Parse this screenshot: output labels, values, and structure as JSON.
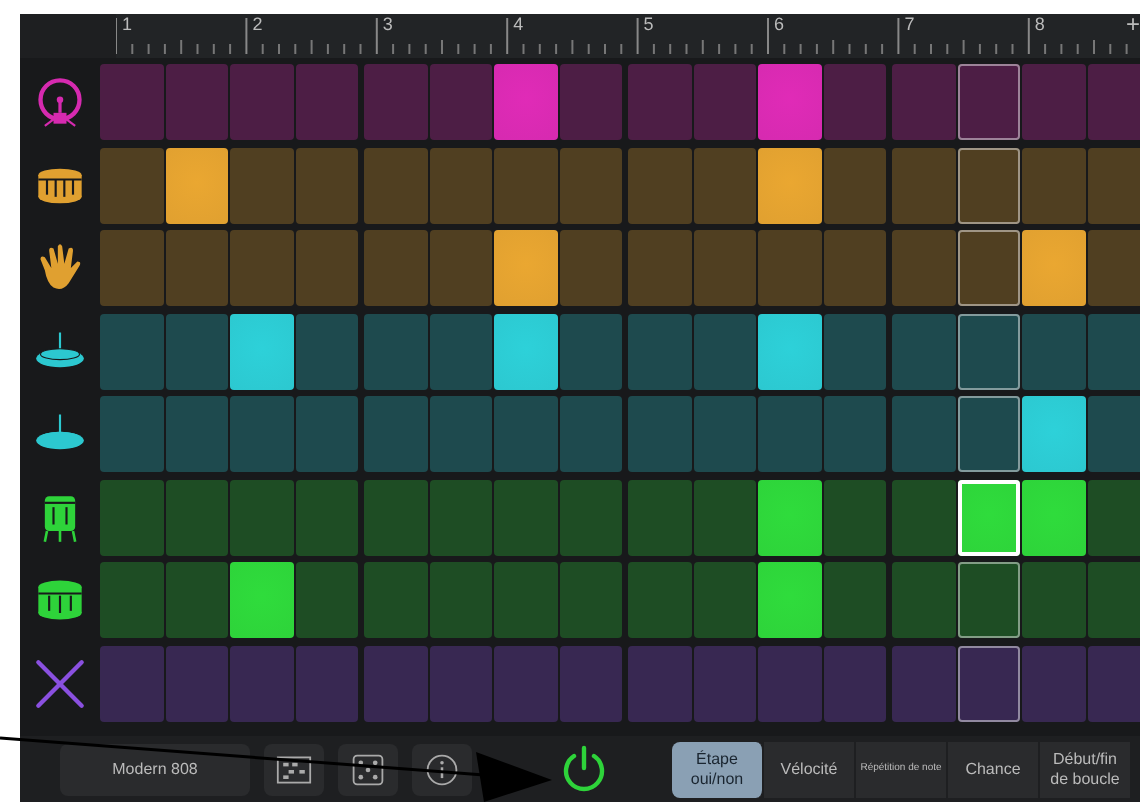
{
  "ruler": {
    "bars": [
      "1",
      "2",
      "3",
      "4",
      "5",
      "6",
      "7",
      "8"
    ],
    "add_label": "+"
  },
  "columns": [
    {
      "current": false
    },
    {
      "current": false
    },
    {
      "current": false
    },
    {
      "current": false
    },
    {
      "current": false
    },
    {
      "current": false
    },
    {
      "current": false
    },
    {
      "current": false
    },
    {
      "current": false
    },
    {
      "current": false
    },
    {
      "current": false
    },
    {
      "current": false
    },
    {
      "current": false
    },
    {
      "current": true
    },
    {
      "current": false
    },
    {
      "current": false
    }
  ],
  "rows": [
    {
      "kind": "kick",
      "color": "#d62ab0",
      "selected": false,
      "steps": [
        false,
        false,
        false,
        false,
        false,
        false,
        true,
        false,
        false,
        false,
        true,
        false,
        false,
        false,
        false,
        false
      ]
    },
    {
      "kind": "snare",
      "color": "#e0a030",
      "selected": false,
      "steps": [
        false,
        true,
        false,
        false,
        false,
        false,
        false,
        false,
        false,
        false,
        true,
        false,
        false,
        false,
        false,
        false
      ]
    },
    {
      "kind": "clap",
      "color": "#e0a030",
      "selected": false,
      "steps": [
        false,
        false,
        false,
        false,
        false,
        false,
        true,
        false,
        false,
        false,
        false,
        false,
        false,
        false,
        true,
        false
      ]
    },
    {
      "kind": "hihat",
      "color": "#2cc8d0",
      "selected": false,
      "steps": [
        false,
        false,
        true,
        false,
        false,
        false,
        true,
        false,
        false,
        false,
        true,
        false,
        false,
        false,
        false,
        false
      ]
    },
    {
      "kind": "cymbal",
      "color": "#2cc8d0",
      "selected": false,
      "steps": [
        false,
        false,
        false,
        false,
        false,
        false,
        false,
        false,
        false,
        false,
        false,
        false,
        false,
        false,
        true,
        false
      ]
    },
    {
      "kind": "floortom",
      "color": "#2ed33a",
      "selected": true,
      "steps": [
        false,
        false,
        false,
        false,
        false,
        false,
        false,
        false,
        false,
        false,
        true,
        false,
        false,
        true,
        true,
        false
      ]
    },
    {
      "kind": "tom",
      "color": "#2ed33a",
      "selected": false,
      "steps": [
        false,
        false,
        true,
        false,
        false,
        false,
        false,
        false,
        false,
        false,
        true,
        false,
        false,
        false,
        false,
        false
      ]
    },
    {
      "kind": "sticks",
      "color": "#8a50e0",
      "selected": false,
      "steps": [
        false,
        false,
        false,
        false,
        false,
        false,
        false,
        false,
        false,
        false,
        false,
        false,
        false,
        false,
        false,
        false
      ]
    }
  ],
  "toolbar": {
    "kit": "Modern 808",
    "power_on": true
  },
  "modes": [
    {
      "label": "Étape\noui/non",
      "selected": true,
      "kind": "normal"
    },
    {
      "label": "Vélocité",
      "selected": false,
      "kind": "normal"
    },
    {
      "label": "Répétition de note",
      "selected": false,
      "kind": "tiny"
    },
    {
      "label": "Chance",
      "selected": false,
      "kind": "normal"
    },
    {
      "label": "Début/fin\nde boucle",
      "selected": false,
      "kind": "normal"
    }
  ]
}
